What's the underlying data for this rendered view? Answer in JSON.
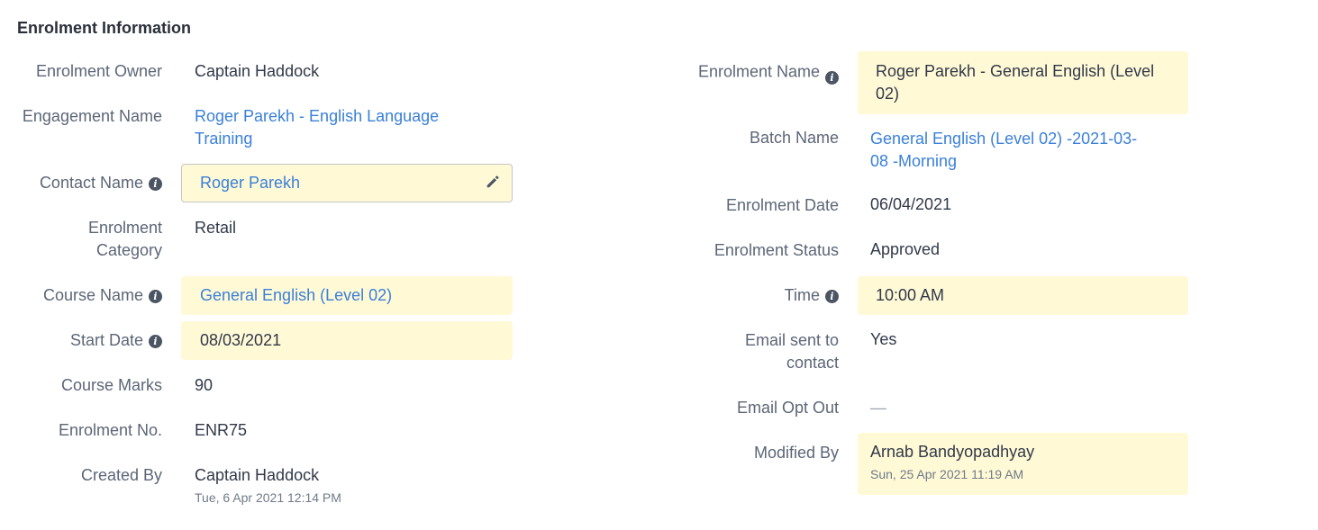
{
  "section": {
    "title": "Enrolment Information"
  },
  "left": {
    "enrolment_owner": {
      "label": "Enrolment Owner",
      "value": "Captain Haddock"
    },
    "engagement_name": {
      "label": "Engagement Name",
      "value_line1": "Roger Parekh - English Language",
      "value_line2": "Training"
    },
    "contact_name": {
      "label": "Contact Name",
      "value": "Roger Parekh"
    },
    "enrolment_category": {
      "label_line1": "Enrolment",
      "label_line2": "Category",
      "value": "Retail"
    },
    "course_name": {
      "label": "Course Name",
      "value": "General English (Level 02)"
    },
    "start_date": {
      "label": "Start Date",
      "value": "08/03/2021"
    },
    "course_marks": {
      "label": "Course Marks",
      "value": "90"
    },
    "enrolment_no": {
      "label": "Enrolment No.",
      "value": "ENR75"
    },
    "created_by": {
      "label": "Created By",
      "value": "Captain Haddock",
      "timestamp": "Tue, 6 Apr 2021 12:14 PM"
    }
  },
  "right": {
    "enrolment_name": {
      "label": "Enrolment Name",
      "value_line1": "Roger Parekh - General English (Level",
      "value_line2": "02)"
    },
    "batch_name": {
      "label": "Batch Name",
      "value_line1": "General English (Level 02) -2021-03-",
      "value_line2": "08 -Morning"
    },
    "enrolment_date": {
      "label": "Enrolment Date",
      "value": "06/04/2021"
    },
    "enrolment_status": {
      "label": "Enrolment Status",
      "value": "Approved"
    },
    "time": {
      "label": "Time",
      "value": "10:00 AM"
    },
    "email_sent": {
      "label_line1": "Email sent to",
      "label_line2": "contact",
      "value": "Yes"
    },
    "email_opt_out": {
      "label": "Email Opt Out",
      "value": "—"
    },
    "modified_by": {
      "label": "Modified By",
      "value": "Arnab Bandyopadhyay",
      "timestamp": "Sun, 25 Apr 2021 11:19 AM"
    }
  },
  "icons": {
    "info": "info-icon",
    "edit": "pencil-icon"
  },
  "colors": {
    "link": "#3a80d8",
    "highlight": "#fff9d6",
    "label": "#5c6677"
  }
}
